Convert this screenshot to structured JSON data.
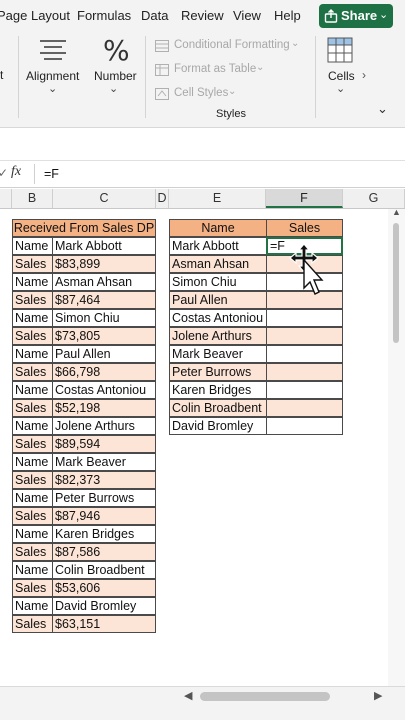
{
  "menu": {
    "page_layout": "Page Layout",
    "formulas": "Formulas",
    "data": "Data",
    "review": "Review",
    "view": "View",
    "help": "Help",
    "share": "Share"
  },
  "ribbon": {
    "font_partial": "t",
    "alignment": "Alignment",
    "number": "Number",
    "conditional_formatting": "Conditional Formatting",
    "format_as_table": "Format as Table",
    "cell_styles": "Cell Styles",
    "styles_group": "Styles",
    "cells": "Cells"
  },
  "formula_bar": {
    "fx": "fx",
    "value": "=F"
  },
  "columns": [
    "B",
    "C",
    "D",
    "E",
    "F",
    "G"
  ],
  "table1": {
    "header": "Received From Sales DP",
    "rows": [
      [
        "Name",
        "Mark Abbott"
      ],
      [
        "Sales",
        "$83,899"
      ],
      [
        "Name",
        "Asman Ahsan"
      ],
      [
        "Sales",
        "$87,464"
      ],
      [
        "Name",
        "Simon Chiu"
      ],
      [
        "Sales",
        "$73,805"
      ],
      [
        "Name",
        "Paul Allen"
      ],
      [
        "Sales",
        "$66,798"
      ],
      [
        "Name",
        "Costas Antoniou"
      ],
      [
        "Sales",
        "$52,198"
      ],
      [
        "Name",
        "Jolene Arthurs"
      ],
      [
        "Sales",
        "$89,594"
      ],
      [
        "Name",
        "Mark Beaver"
      ],
      [
        "Sales",
        "$82,373"
      ],
      [
        "Name",
        "Peter Burrows"
      ],
      [
        "Sales",
        "$87,946"
      ],
      [
        "Name",
        "Karen Bridges"
      ],
      [
        "Sales",
        "$87,586"
      ],
      [
        "Name",
        "Colin Broadbent"
      ],
      [
        "Sales",
        "$53,606"
      ],
      [
        "Name",
        "David Bromley"
      ],
      [
        "Sales",
        "$63,151"
      ]
    ]
  },
  "table2": {
    "header_name": "Name",
    "header_sales": "Sales",
    "names": [
      "Mark Abbott",
      "Asman Ahsan",
      "Simon Chiu",
      "Paul Allen",
      "Costas Antoniou",
      "Jolene Arthurs",
      "Mark Beaver",
      "Peter Burrows",
      "Karen Bridges",
      "Colin Broadbent",
      "David Bromley"
    ],
    "active_cell_value": "=F"
  },
  "colors": {
    "header_fill": "#f4b183",
    "band_fill": "#fce4d6",
    "share_green": "#1e7145",
    "selection_green": "#217346"
  }
}
